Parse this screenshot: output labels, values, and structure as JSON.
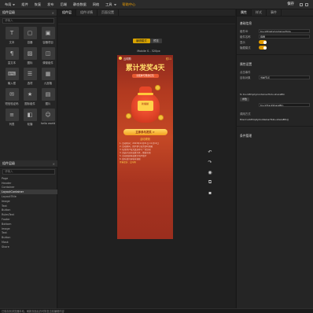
{
  "menubar": {
    "items": [
      "布局",
      "组件",
      "恢复",
      "发布",
      "后端",
      "静态数据",
      "网络",
      "工具",
      "帮助中心"
    ],
    "save_label": "保存"
  },
  "left_panel": {
    "title": "组件层级",
    "search_placeholder": "请输入",
    "components": [
      "文本",
      "容器",
      "容器项目",
      "富文本",
      "图标",
      "弹窗组件",
      "输入框",
      "选项",
      "九宫格",
      "短信验证码",
      "图标组件",
      "图片",
      "列表",
      "轮播",
      "hello world"
    ],
    "tree": [
      "Page",
      "  Header",
      "  Container",
      "    LayoutContainer",
      "    LayoutTitle",
      "    Image",
      "    Text",
      "    Button",
      "    RulesText",
      "    Footer",
      "  Bottom",
      "    Image",
      "    Text",
      "    Button",
      "    Mask",
      "    Share"
    ]
  },
  "center": {
    "tabs": [
      "组件层",
      "组件详情",
      "页面设置"
    ],
    "zoom_buttons": [
      "编辑模式",
      "预览"
    ],
    "device_label": "Mobile S - 320px",
    "phone": {
      "brand": "云闪购",
      "brand_right": "双11",
      "headline": "累计发奖4天",
      "subtitle": "全民参与现金红包",
      "bag_tag": "新福袋",
      "cta": "立即参与发奖 >",
      "rules_title": "活动规则",
      "rules": [
        "1. 活动时间：2023年11月01日-11月11日",
        "2. 活动期间，用户参与任务即可领取",
        "3. 每位用户每天最多参与一次活动",
        "4. 奖品以实际发放为准，数量有限",
        "5. 活动奖励将发放至用户账户",
        "6. 如有疑问请联系客服"
      ],
      "more": "查看更多：云闪购"
    }
  },
  "right_panel": {
    "tabs": [
      "属性",
      "样式",
      "事件"
    ],
    "basic_title": "基础信息",
    "fields": [
      {
        "key": "组件ID",
        "value": "truckEmptyContainerTo2u"
      },
      {
        "key": "组件名称",
        "value": "容器"
      }
    ],
    "toggles": [
      "显示",
      "隐藏模式"
    ],
    "attr_title": "属性设置",
    "event_title": "点击事件",
    "event_key": "目标对象",
    "event_value": "当前节点",
    "handler": "fn truckEmptyContainerTo2u.shareBtn",
    "params_label": "参数",
    "param_value": "truckTrackShareBtn",
    "method_label": "调用方式",
    "method_value": "this.truckEmptyContainerTo2u.shareBtn()",
    "more_title": "条件管理"
  },
  "status_bar": "已保存到浏览器本地，刷新页面后仍可恢复当前编辑内容"
}
